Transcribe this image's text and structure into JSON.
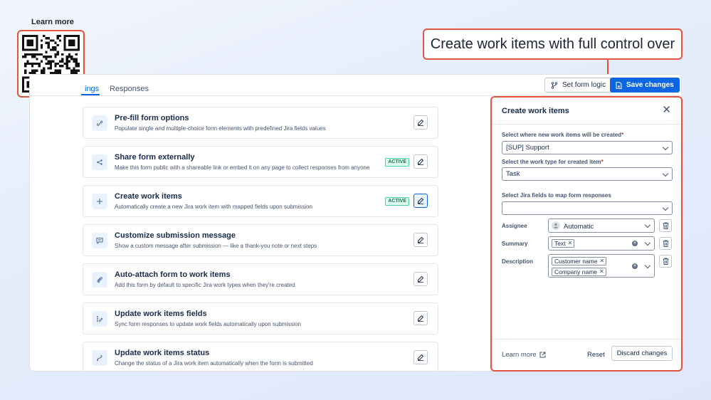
{
  "qr": {
    "label": "Learn more"
  },
  "callout": {
    "text": "Create work items with full control over"
  },
  "tabs": [
    {
      "label": "ings"
    },
    {
      "label": "Responses"
    }
  ],
  "toolbar": {
    "set_form_logic": "Set form logic",
    "save_changes": "Save changes"
  },
  "list": {
    "badge": "ACTIVE",
    "items": [
      {
        "title": "Pre-fill form options",
        "desc": "Populate single and multiple-choice form elements with predefined Jira fields values",
        "icon": "link-icon",
        "active": false
      },
      {
        "title": "Share form externally",
        "desc": "Make this form public with a shareable link or embed it on any page to collect responses from anyone",
        "icon": "share-icon",
        "active": true
      },
      {
        "title": "Create work items",
        "desc": "Automatically create a new Jira work item with mapped fields upon submission",
        "icon": "plus-icon",
        "active": true
      },
      {
        "title": "Customize submission message",
        "desc": "Show a custom message after submission — like a thank-you note or next steps",
        "icon": "message-icon",
        "active": false
      },
      {
        "title": "Auto-attach form to work items",
        "desc": "Add this form by default to specific Jira work types when they're created",
        "icon": "attachment-icon",
        "active": false
      },
      {
        "title": "Update work items fields",
        "desc": "Sync form responses to update work fields automatically upon submission",
        "icon": "fields-edit-icon",
        "active": false
      },
      {
        "title": "Update work items status",
        "desc": "Change the status of a Jira work item automatically when the form is submitted",
        "icon": "status-transition-icon",
        "active": false
      }
    ]
  },
  "panel": {
    "title": "Create work items",
    "project_label": "Select where new work items will be created",
    "project_value": "[SUP] Support",
    "type_label": "Select the work type for created item",
    "type_value": "Task",
    "fields_label": "Select Jira fields to map form responses",
    "fields_value": "",
    "mappings": {
      "assignee": {
        "label": "Assignee",
        "value": "Automatic"
      },
      "summary": {
        "label": "Summary",
        "tags": [
          "Text"
        ]
      },
      "description": {
        "label": "Description",
        "tags": [
          "Customer name",
          "Company name"
        ]
      }
    },
    "footer": {
      "learn_more": "Learn more",
      "reset": "Reset",
      "discard": "Discard changes"
    }
  },
  "colors": {
    "accent": "#0c66e4",
    "highlight": "#e5533d",
    "active_badge": "#216e4e"
  }
}
